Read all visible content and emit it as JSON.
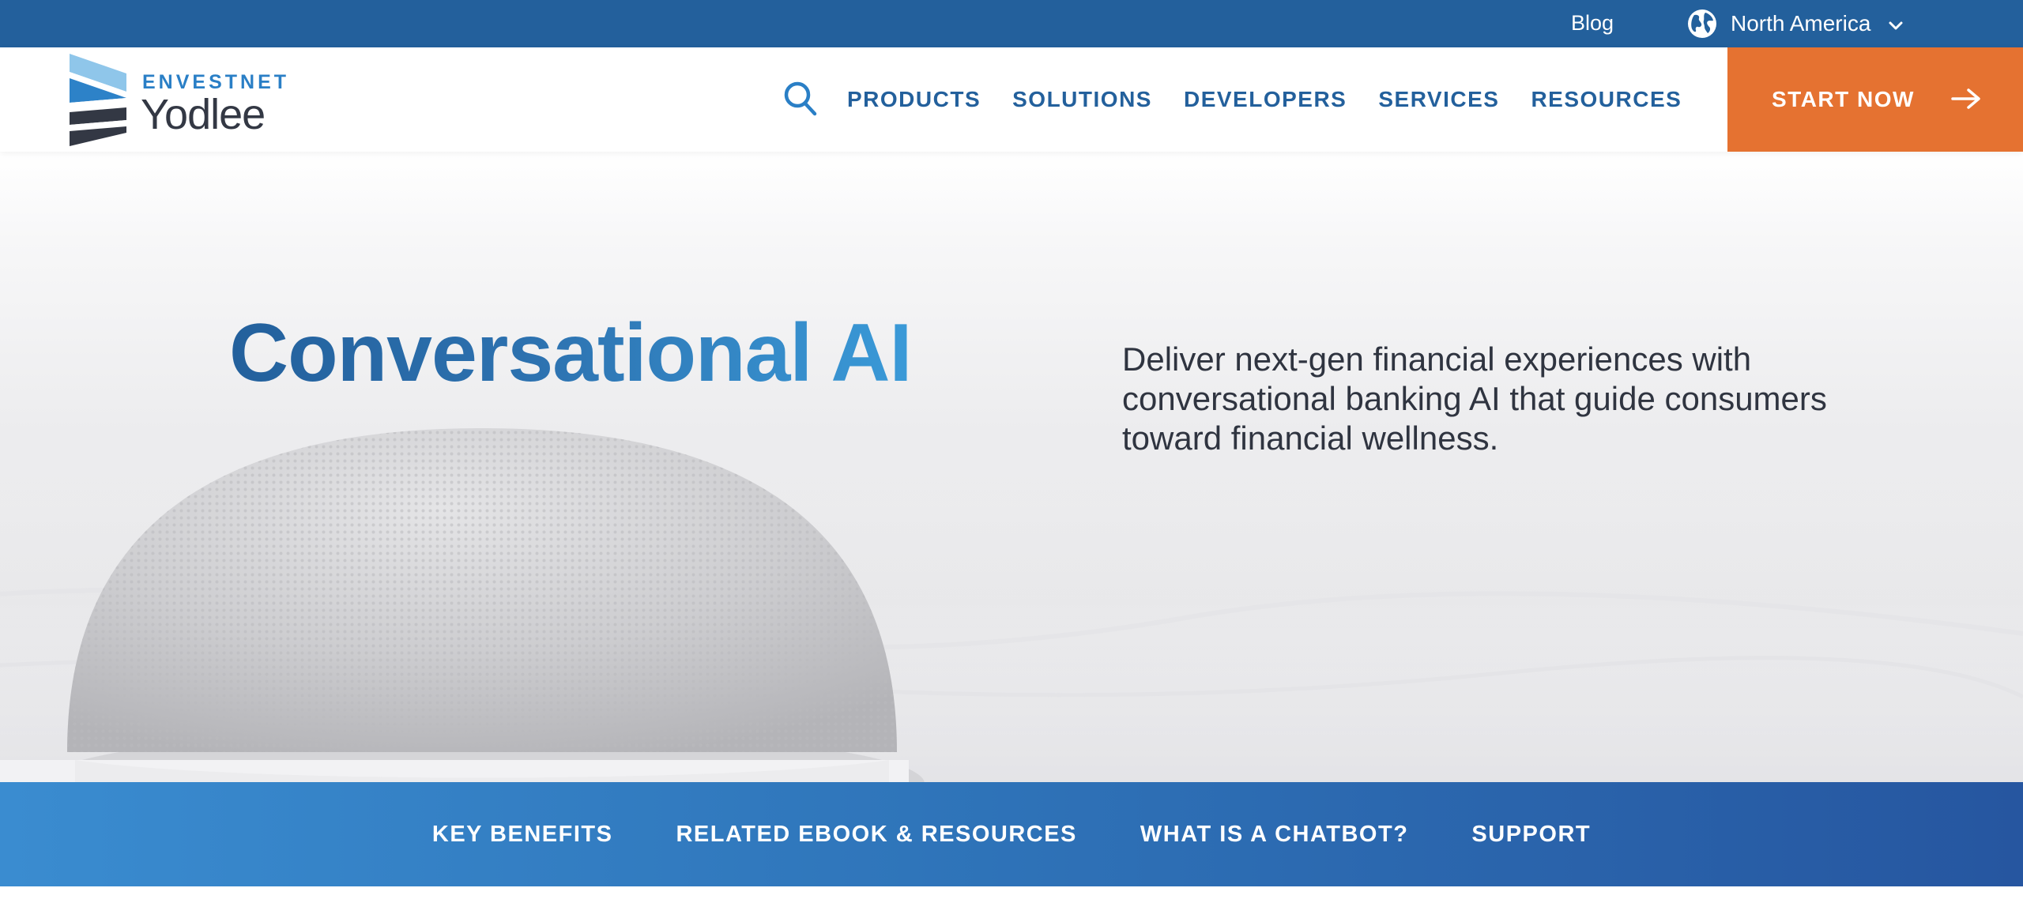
{
  "utility_bar": {
    "blog_label": "Blog",
    "region_label": "North America",
    "region_icon": "globe-icon",
    "dropdown_icon": "chevron-down-icon"
  },
  "header": {
    "logo": {
      "top_text": "ENVESTNET",
      "main_text": "Yodlee"
    },
    "search_icon": "search-icon",
    "nav_items": [
      "PRODUCTS",
      "SOLUTIONS",
      "DEVELOPERS",
      "SERVICES",
      "RESOURCES"
    ],
    "cta": {
      "label": "START NOW",
      "icon": "arrow-right-icon"
    }
  },
  "hero": {
    "title": "Conversational AI",
    "description": "Deliver next-gen financial experiences with conversational banking AI that guide consumers toward financial wellness."
  },
  "section_nav": [
    "KEY BENEFITS",
    "RELATED EBOOK & RESOURCES",
    "WHAT IS A CHATBOT?",
    "SUPPORT"
  ],
  "colors": {
    "utility_bar": "#23609c",
    "nav_text": "#23609c",
    "cta_background": "#e57231",
    "title_gradient_start": "#23609c",
    "title_gradient_end": "#3a9ad8",
    "section_bar_start": "#3a8cd0",
    "section_bar_end": "#2656a0"
  }
}
